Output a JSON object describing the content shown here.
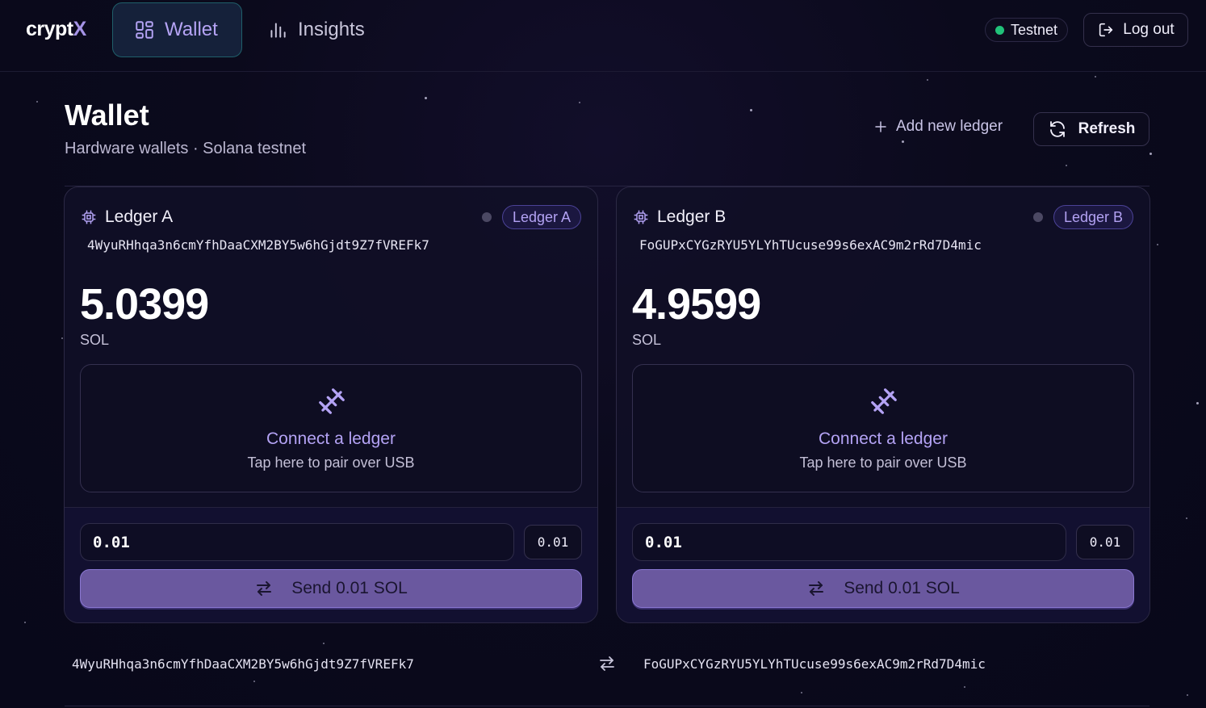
{
  "app": {
    "logo_text": "crypt",
    "logo_accent": "X"
  },
  "nav": {
    "tabs": [
      {
        "label": "Wallet",
        "icon": "grid-icon",
        "active": true
      },
      {
        "label": "Insights",
        "icon": "bar-chart-icon",
        "active": false
      }
    ],
    "network_status": "Testnet",
    "logout_label": "Log out"
  },
  "header": {
    "title": "Wallet",
    "subtitle": "Hardware wallets · Solana testnet",
    "add_ledger_label": "Add new ledger",
    "refresh_label": "Refresh"
  },
  "ledgers": [
    {
      "name": "Ledger A",
      "badge": "Ledger A",
      "address": "4WyuRHhqa3n6cmYfhDaaCXM2BY5w6hGjdt9Z7fVREFk7",
      "balance": "5.0399",
      "unit": "SOL",
      "connect_title": "Connect a ledger",
      "connect_sub": "Tap here to pair over USB",
      "amount_value": "0.01",
      "amount_chip": "0.01",
      "send_label": "Send 0.01 SOL"
    },
    {
      "name": "Ledger B",
      "badge": "Ledger B",
      "address": "FoGUPxCYGzRYU5YLYhTUcuse99s6exAC9m2rRd7D4mic",
      "balance": "4.9599",
      "unit": "SOL",
      "connect_title": "Connect a ledger",
      "connect_sub": "Tap here to pair over USB",
      "amount_value": "0.01",
      "amount_chip": "0.01",
      "send_label": "Send 0.01 SOL"
    }
  ],
  "transfer": {
    "from": "4WyuRHhqa3n6cmYfhDaaCXM2BY5w6hGjdt9Z7fVREFk7",
    "to": "FoGUPxCYGzRYU5YLYhTUcuse99s6exAC9m2rRd7D4mic"
  },
  "colors": {
    "accent": "#b4a3f5",
    "send_button": "#6a589f",
    "status_green": "#21c27a",
    "background": "#0b0a1c"
  }
}
